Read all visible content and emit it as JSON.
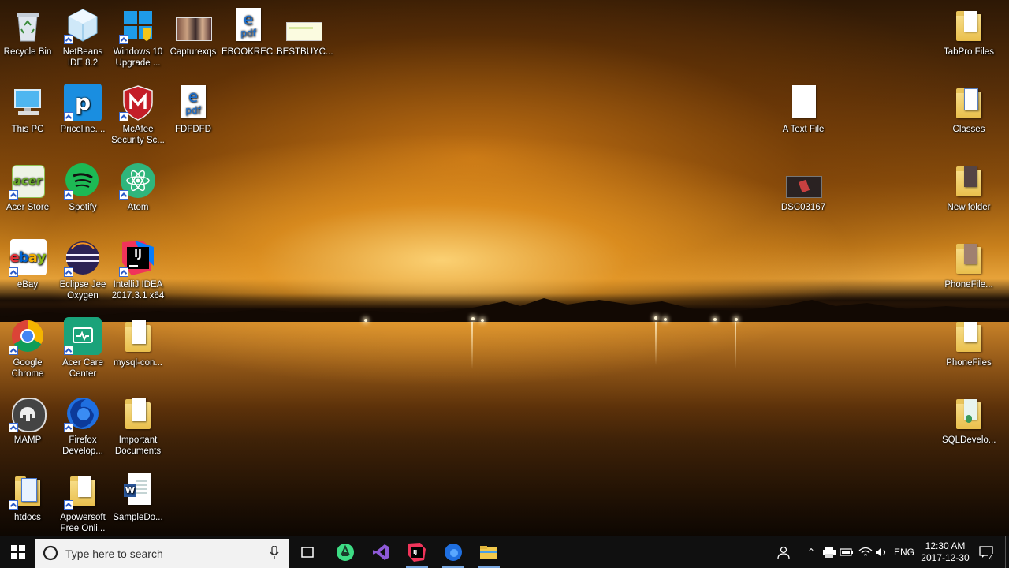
{
  "desktop": {
    "icons": [
      {
        "label": "Recycle Bin"
      },
      {
        "label": "NetBeans IDE 8.2"
      },
      {
        "label": "Windows 10 Upgrade ..."
      },
      {
        "label": "Capturexqs"
      },
      {
        "label": "EBOOKREC..."
      },
      {
        "label": "BESTBUYC..."
      },
      {
        "label": "This PC"
      },
      {
        "label": "Priceline...."
      },
      {
        "label": "McAfee Security Sc..."
      },
      {
        "label": "FDFDFD"
      },
      {
        "label": "Acer Store"
      },
      {
        "label": "Spotify"
      },
      {
        "label": "Atom"
      },
      {
        "label": "eBay"
      },
      {
        "label": "Eclipse Jee Oxygen"
      },
      {
        "label": "IntelliJ IDEA 2017.3.1 x64"
      },
      {
        "label": "Google Chrome"
      },
      {
        "label": "Acer Care Center"
      },
      {
        "label": "mysql-con..."
      },
      {
        "label": "MAMP"
      },
      {
        "label": "Firefox Develop..."
      },
      {
        "label": "Important Documents"
      },
      {
        "label": "htdocs"
      },
      {
        "label": "Apowersoft Free Onli..."
      },
      {
        "label": "SampleDo..."
      },
      {
        "label": "A Text File"
      },
      {
        "label": "DSC03167"
      },
      {
        "label": "TabPro Files"
      },
      {
        "label": "Classes"
      },
      {
        "label": "New folder"
      },
      {
        "label": "PhoneFile..."
      },
      {
        "label": "PhoneFiles"
      },
      {
        "label": "SQLDevelo..."
      }
    ]
  },
  "taskbar": {
    "search_placeholder": "Type here to search",
    "language": "ENG",
    "time": "12:30 AM",
    "date": "2017-12-30",
    "notification_count": "4"
  },
  "icons_semantic": {
    "start": "windows-logo-icon",
    "search": "cortana-circle-icon",
    "mic": "microphone-icon",
    "task_view": "task-view-icon"
  },
  "colors": {
    "taskbar": "#101010",
    "search_box": "#f2f2f2",
    "active_underline": "#7aa8e0"
  }
}
